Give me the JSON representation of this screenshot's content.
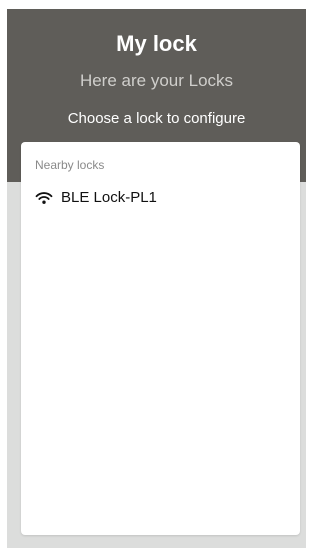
{
  "header": {
    "title": "My lock",
    "subtitle": "Here are your Locks",
    "instruction": "Choose a lock to configure"
  },
  "locks": {
    "section_label": "Nearby locks",
    "items": [
      {
        "name": "BLE Lock-PL1",
        "icon": "wifi-icon"
      }
    ]
  },
  "colors": {
    "header_bg": "#5f5d59",
    "page_bg": "#dcdddc",
    "card_bg": "#ffffff"
  }
}
